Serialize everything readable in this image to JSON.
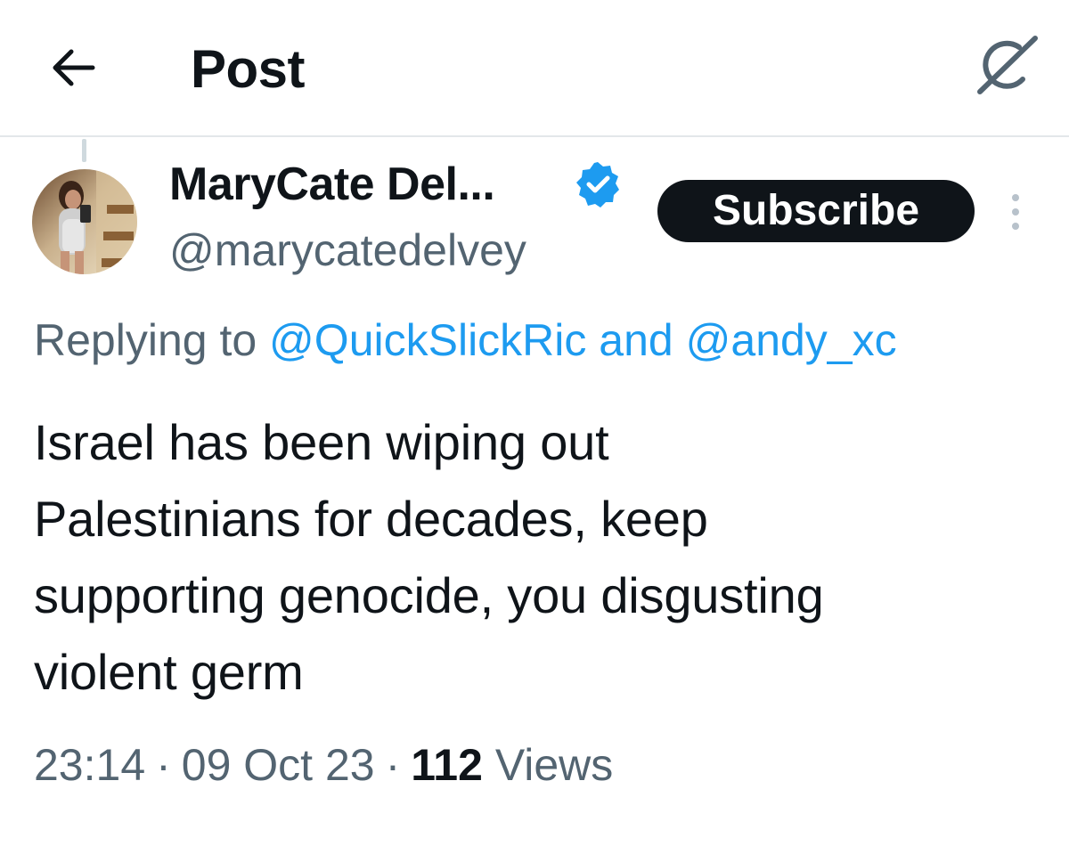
{
  "header": {
    "back_icon": "arrow-left-icon",
    "title": "Post",
    "grok_icon": "grok-icon"
  },
  "author": {
    "name": "MaryCate Del...",
    "handle": "@marycatedelvey",
    "verified": true,
    "verified_color": "#1d9bf0",
    "avatar": "profile-photo"
  },
  "actions": {
    "subscribe_label": "Subscribe",
    "more_icon": "more-vertical-icon"
  },
  "reply_context": {
    "prefix": "Replying to ",
    "mentions": [
      "@QuickSlickRic",
      "@andy_xc"
    ],
    "joiner": " and "
  },
  "tweet": {
    "lines": [
      "Israel has been wiping out",
      "Palestinians for decades, keep",
      "supporting genocide, you disgusting",
      "violent germ"
    ]
  },
  "meta": {
    "time": "23:14",
    "date": "09 Oct 23",
    "separator": "·",
    "views_count": "112",
    "views_label": "Views"
  },
  "colors": {
    "accent": "#1d9bf0",
    "text_primary": "#0f1419",
    "text_secondary": "#536471",
    "divider": "#e3e7ea"
  }
}
